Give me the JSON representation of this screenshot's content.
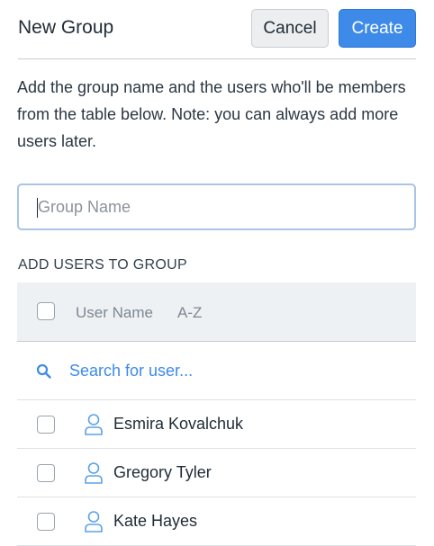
{
  "header": {
    "title": "New Group",
    "cancel_label": "Cancel",
    "create_label": "Create"
  },
  "description": "Add the group name and the users who'll be members from the table below. Note: you can always add more users later.",
  "group_name": {
    "placeholder": "Group Name",
    "value": ""
  },
  "section_label": "ADD USERS TO GROUP",
  "table": {
    "column_user": "User Name",
    "sort_label": "A-Z"
  },
  "search": {
    "placeholder": "Search for user..."
  },
  "users": [
    {
      "name": "Esmira Kovalchuk",
      "checked": false
    },
    {
      "name": "Gregory Tyler",
      "checked": false
    },
    {
      "name": "Kate Hayes",
      "checked": false
    }
  ],
  "colors": {
    "accent": "#3d8ae8",
    "text": "#1f2b36",
    "muted": "#7d8891"
  },
  "icons": {
    "search": "search-icon",
    "user": "user-icon"
  }
}
